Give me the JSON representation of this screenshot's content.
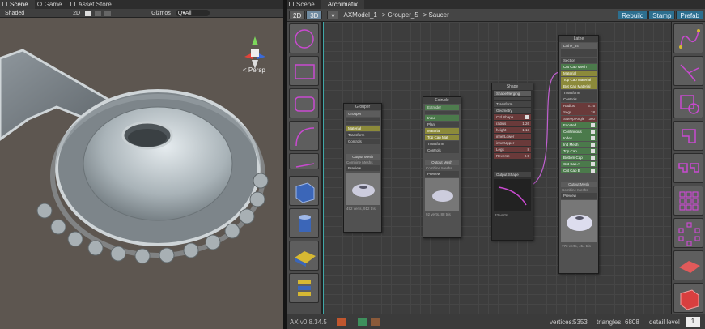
{
  "colors": {
    "accent_blue": "#2d6f8f",
    "wire_magenta": "#c060d0",
    "cyan_guide": "#3fbfbf",
    "node_yellow": "#8c8a3a",
    "node_green": "#4b7a4b"
  },
  "left_tabs": [
    {
      "label": "Scene",
      "icon": "grid-icon",
      "active": true
    },
    {
      "label": "Game",
      "icon": "pacman-icon",
      "active": false
    },
    {
      "label": "Asset Store",
      "icon": "bag-icon",
      "active": false
    }
  ],
  "scene_toolbar": {
    "shading": "Shaded",
    "mode_2d": "2D",
    "gizmos": "Gizmos",
    "search_prefix": "Q▾All"
  },
  "scene_gizmo": {
    "persp_label": "< Persp",
    "axes": [
      "y",
      "x",
      "z"
    ]
  },
  "right_tabs": [
    {
      "label": "Scene",
      "icon": "grid-icon",
      "active": false
    },
    {
      "label": "Archimatix",
      "icon": "",
      "active": true
    }
  ],
  "ax_toolbar": {
    "btn_2d": "2D",
    "btn_3d": "3D",
    "breadcrumb": [
      "AXModel_1",
      "Grouper_5",
      "Saucer"
    ],
    "rebuild": "Rebuild",
    "stamp": "Stamp",
    "prefab": "Prefab"
  },
  "nodes": {
    "grouper": {
      "title": "Grouper",
      "name": "Grouper",
      "material": "Material",
      "transform": "Transform",
      "controls": "Controls",
      "output": "Output Mesh",
      "combine": "Combine Meshs",
      "preview": "Preview",
      "stats": "492 verts, 912 tris"
    },
    "extrude": {
      "title": "Extrude",
      "name": "Extruder",
      "input": "Input",
      "plan": "Plan",
      "material": "Material",
      "top_cap": "Top Cap Mat",
      "transform": "Transform",
      "controls": "Controls",
      "output": "Output Mesh",
      "combine": "Combine Meshs",
      "preview": "Preview",
      "stats": "92 verts, 88 tris"
    },
    "shape": {
      "title": "Shape",
      "name": "ShapeMerging",
      "transform": "Transform",
      "geometry": "Geometry",
      "params": [
        "Ctrl Shape",
        "radius",
        "height",
        "innerLower",
        "innerUpper",
        "Legs",
        "Reverse"
      ],
      "values": [
        "",
        "1.26",
        "1.13",
        "",
        "",
        "8",
        "0.5"
      ],
      "output": "Output Shape",
      "stats": "33 verts"
    },
    "lathe": {
      "title": "Lathe",
      "name": "Lathe_84",
      "section": "Section",
      "cut_cap": "Cut Cap Mesh",
      "material": "Material",
      "top_cap_mat": "Top Cap Material",
      "bottom_cap_mat": "Bot Cap Material",
      "transform": "Transform",
      "controls": "Controls",
      "params": [
        "Radius",
        "Segs",
        "Sweep Angle",
        "Faceted",
        "Continuous",
        "Index",
        "Ind Mesh",
        "Top Cap",
        "Bottom Cap",
        "Cut Cap A",
        "Cut Cap B"
      ],
      "values": [
        "3.75",
        "18",
        "360",
        "",
        "",
        "",
        "",
        "",
        "",
        "",
        ""
      ],
      "output": "Output Mesh",
      "combine": "Combine Meshs",
      "preview": "Preview",
      "stats": "773 verts, 454 tris"
    }
  },
  "status": {
    "version": "AX v0.8.34.5",
    "vertices_label": "vertices:",
    "vertices": "5353",
    "triangles_label": "triangles:",
    "triangles": "6808",
    "detail_label": "detail level",
    "detail_value": "1"
  },
  "left_palette": [
    "circle-shape-icon",
    "rectangle-shape-icon",
    "rounded-rect-shape-icon",
    "arc-shape-icon",
    "line-shape-icon",
    "box-mesh-icon",
    "cylinder-mesh-icon",
    "extrude-mesh-icon",
    "stack-mesh-icon"
  ],
  "right_palette": [
    "curve-icon",
    "branch-icon",
    "offset-icon",
    "corner-icon",
    "double-corner-icon",
    "grid-repeater-icon",
    "radial-repeater-icon",
    "plane-icon",
    "box-red-icon"
  ]
}
